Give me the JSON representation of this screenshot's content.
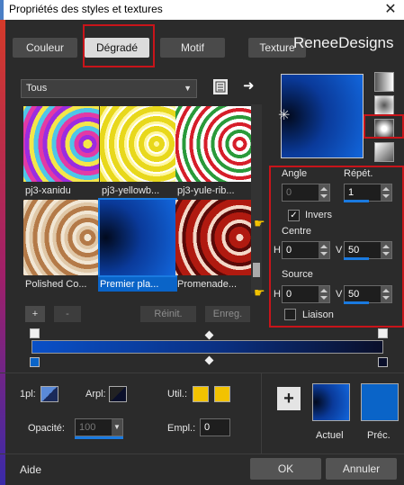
{
  "window": {
    "title": "Propriétés des styles et textures",
    "close_glyph": "✕"
  },
  "watermark": "ReneeDesigns",
  "tabs": [
    {
      "label": "Couleur"
    },
    {
      "label": "Dégradé"
    },
    {
      "label": "Motif"
    },
    {
      "label": "Texture"
    }
  ],
  "category": {
    "value": "Tous"
  },
  "thumbnails": [
    {
      "label": "pj3-xanidu"
    },
    {
      "label": "pj3-yellowb..."
    },
    {
      "label": "pj3-yule-rib..."
    },
    {
      "label": "Polished Co..."
    },
    {
      "label": "Premier pla..."
    },
    {
      "label": "Promenade..."
    }
  ],
  "list_buttons": {
    "add": "+",
    "remove": "-",
    "reset": "Réinit.",
    "save": "Enreg."
  },
  "angle": {
    "label": "Angle",
    "value": "0"
  },
  "repeat": {
    "label": "Répét.",
    "value": "1"
  },
  "invert": {
    "label": "Invers",
    "checked": true
  },
  "center": {
    "label": "Centre",
    "h_label": "H",
    "h_value": "0",
    "v_label": "V",
    "v_value": "50"
  },
  "source": {
    "label": "Source",
    "h_label": "H",
    "h_value": "0",
    "v_label": "V",
    "v_value": "50"
  },
  "link": {
    "label": "Liaison",
    "checked": false
  },
  "bottom": {
    "ipl_label": "1pl:",
    "arpl_label": "Arpl:",
    "util_label": "Util.:",
    "opacity_label": "Opacité:",
    "opacity_value": "100",
    "empl_label": "Empl.:",
    "empl_value": "0",
    "add_glyph": "+",
    "current_label": "Actuel",
    "previous_label": "Préc."
  },
  "footer": {
    "help": "Aide",
    "ok": "OK",
    "cancel": "Annuler"
  },
  "colors": {
    "accent_blue": "#0a64c8",
    "highlight_red": "#c8141a",
    "swatch_yellow": "#f2c200"
  }
}
